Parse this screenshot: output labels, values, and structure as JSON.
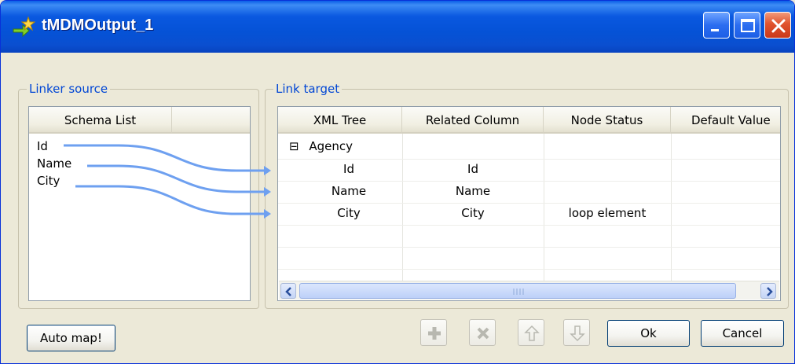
{
  "window": {
    "title": "tMDMOutput_1",
    "title_bar_color": "#0a58e0"
  },
  "source": {
    "legend": "Linker source",
    "column_header": "Schema List",
    "items": [
      "Id",
      "Name",
      "City"
    ]
  },
  "target": {
    "legend": "Link target",
    "columns": [
      "XML Tree",
      "Related Column",
      "Node Status",
      "Default Value"
    ],
    "root_node": {
      "expander": "⊟",
      "label": "Agency"
    },
    "rows": [
      {
        "xml_tree": "Id",
        "related_column": "Id",
        "node_status": "",
        "default_value": ""
      },
      {
        "xml_tree": "Name",
        "related_column": "Name",
        "node_status": "",
        "default_value": ""
      },
      {
        "xml_tree": "City",
        "related_column": "City",
        "node_status": "loop element",
        "default_value": ""
      }
    ]
  },
  "buttons": {
    "auto_map": "Auto map!",
    "ok": "Ok",
    "cancel": "Cancel"
  },
  "toolbar_icons": [
    "add-icon",
    "delete-icon",
    "move-up-icon",
    "move-down-icon"
  ],
  "colors": {
    "legend_text": "#0046d5",
    "link_line": "#6ea0f0"
  }
}
